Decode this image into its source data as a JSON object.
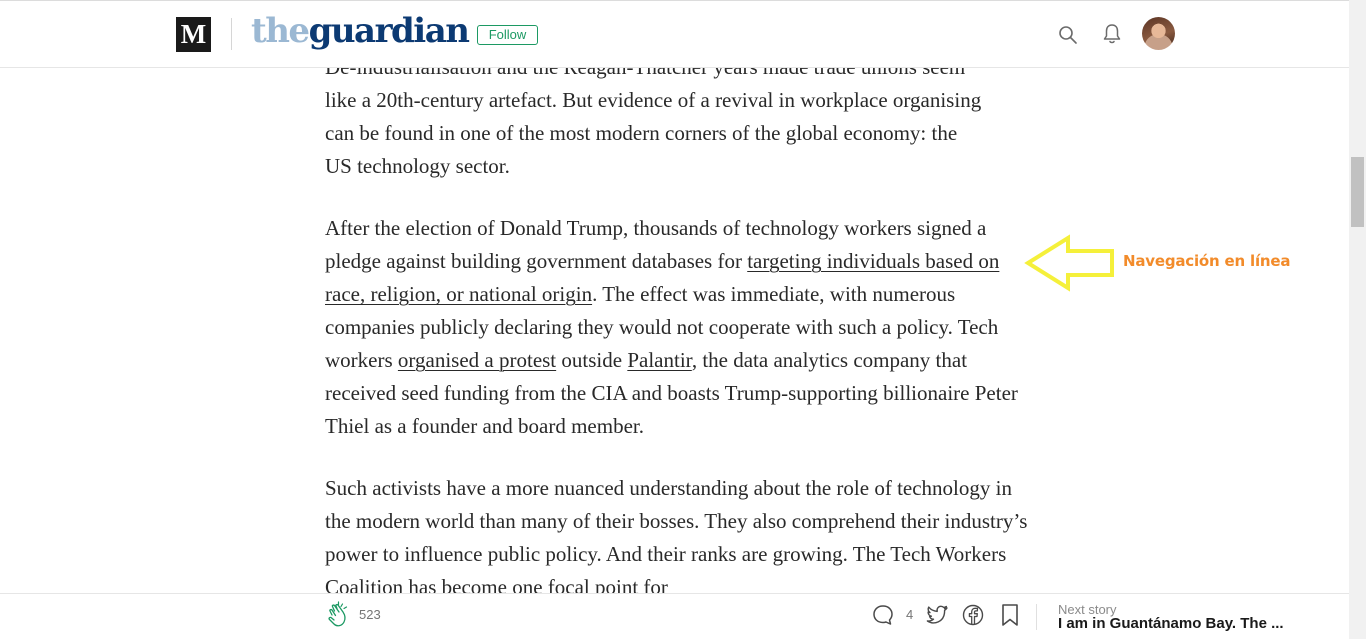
{
  "header": {
    "site_logo": "M",
    "publication": {
      "prefix": "the",
      "name": "guardian"
    },
    "follow_label": "Follow",
    "icons": [
      "search-icon",
      "bell-icon",
      "avatar"
    ]
  },
  "article": {
    "paragraphs": [
      {
        "lines": [
          "De-industrialisation and the Reagan-Thatcher years made trade unions seem",
          "like a 20th-century artefact. But evidence of a revival in workplace organising",
          "can be found in one of the most modern corners of the global economy: the",
          "US technology sector."
        ]
      },
      {
        "text_1": "After the election of Donald Trump, thousands of technology workers signed a pledge against building government databases for ",
        "link_1": "targeting individuals based on race, religion, or national origin",
        "text_2": ". The effect was immediate, with numerous companies publicly declaring they would not cooperate with such a policy. Tech workers ",
        "link_2": "organised a protest",
        "text_3": " outside ",
        "link_3": "Palantir",
        "text_4": ", the data analytics company that received seed funding from the CIA and boasts Trump-supporting billionaire Peter Thiel as a founder and board member."
      },
      {
        "text": "Such activists have a more nuanced understanding about the role of technology in the modern world than many of their bosses. They also comprehend their industry’s power to influence public policy. And their ranks are growing. The Tech Workers Coalition has become one focal point for"
      }
    ]
  },
  "annotation": {
    "label": "Navegación en línea",
    "color": "#f28b2a",
    "arrow_color": "#f5f03a"
  },
  "footer": {
    "clap_count": "523",
    "response_count": "4",
    "next_label": "Next story",
    "next_title": "I am in Guantánamo Bay. The ..."
  },
  "colors": {
    "accent_green": "#1c9963",
    "guardian_navy": "#0c3a73",
    "guardian_light": "#9bb8d3",
    "text": "#292929"
  }
}
